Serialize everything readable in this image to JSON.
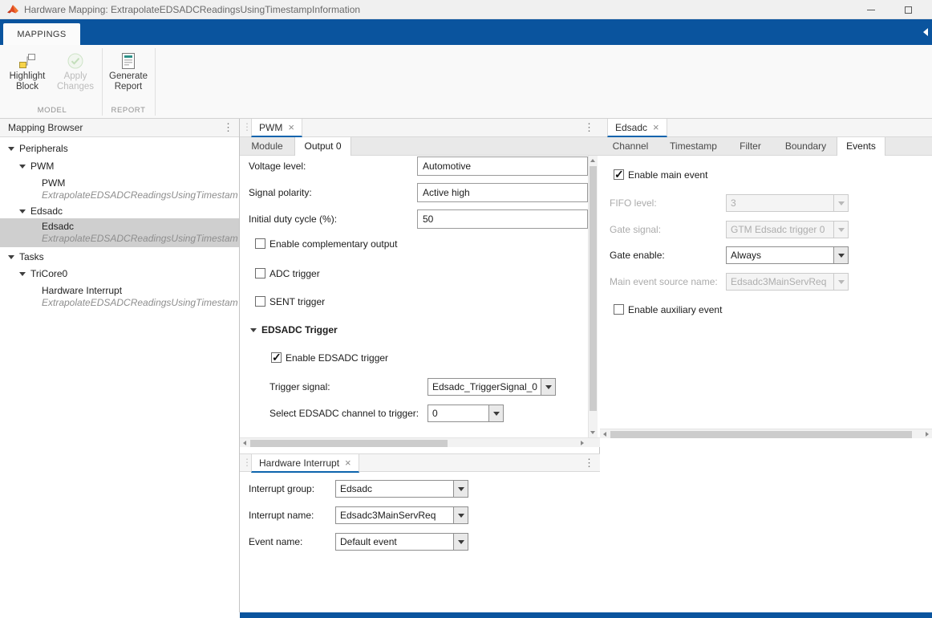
{
  "colors": {
    "ribbon_blue": "#0a549e",
    "tab_accent": "#0d64ad",
    "selected_tree_bg": "#cfcfcf"
  },
  "icons": {
    "menu_dots": "⋮",
    "close": "×"
  },
  "title_bar": {
    "title": "Hardware Mapping: ExtrapolateEDSADCReadingsUsingTimestampInformation"
  },
  "ribbon": {
    "tab": "MAPPINGS"
  },
  "toolbar": {
    "highlight_block": {
      "line1": "Highlight",
      "line2": "Block"
    },
    "apply_changes": {
      "line1": "Apply",
      "line2": "Changes"
    },
    "generate_report": {
      "line1": "Generate",
      "line2": "Report"
    },
    "sections": {
      "model": "MODEL",
      "report": "REPORT"
    }
  },
  "browser": {
    "header": "Mapping Browser",
    "items": [
      {
        "label": "Peripherals"
      },
      {
        "label": "PWM"
      },
      {
        "label": "PWM",
        "sub": "ExtrapolateEDSADCReadingsUsingTimestam"
      },
      {
        "label": "Edsadc"
      },
      {
        "label": "Edsadc",
        "sub": "ExtrapolateEDSADCReadingsUsingTimestam",
        "selected": true
      },
      {
        "label": "Tasks"
      },
      {
        "label": "TriCore0"
      },
      {
        "label": "Hardware Interrupt",
        "sub": "ExtrapolateEDSADCReadingsUsingTimestam"
      }
    ]
  },
  "pwm": {
    "tab": "PWM",
    "subtabs": [
      "Module",
      "Output 0"
    ],
    "active_subtab": "Output 0",
    "voltage_level": {
      "label": "Voltage level:",
      "value": "Automotive"
    },
    "signal_polarity": {
      "label": "Signal polarity:",
      "value": "Active high"
    },
    "initial_duty": {
      "label": "Initial duty cycle (%):",
      "value": "50"
    },
    "enable_complementary": {
      "label": "Enable complementary output",
      "checked": false
    },
    "adc_trigger": {
      "label": "ADC trigger",
      "checked": false
    },
    "sent_trigger": {
      "label": "SENT trigger",
      "checked": false
    },
    "edsadc_trigger_section": "EDSADC Trigger",
    "enable_edsadc_trigger": {
      "label": "Enable EDSADC trigger",
      "checked": true
    },
    "trigger_signal": {
      "label": "Trigger signal:",
      "value": "Edsadc_TriggerSignal_0"
    },
    "edsadc_channel": {
      "label": "Select EDSADC channel to trigger:",
      "value": "0"
    }
  },
  "edsadc": {
    "tab": "Edsadc",
    "subtabs": [
      "Channel",
      "Timestamp",
      "Filter",
      "Boundary",
      "Events"
    ],
    "active_subtab": "Events",
    "enable_main_event": {
      "label": "Enable main event",
      "checked": true
    },
    "fifo_level": {
      "label": "FIFO level:",
      "value": "3",
      "disabled": true
    },
    "gate_signal": {
      "label": "Gate signal:",
      "value": "GTM Edsadc trigger 0",
      "disabled": true
    },
    "gate_enable": {
      "label": "Gate enable:",
      "value": "Always",
      "disabled": false
    },
    "main_event_source": {
      "label": "Main event source name:",
      "value": "Edsadc3MainServReq",
      "disabled": true
    },
    "enable_aux_event": {
      "label": "Enable auxiliary event",
      "checked": false
    }
  },
  "hw_interrupt": {
    "tab": "Hardware Interrupt",
    "interrupt_group": {
      "label": "Interrupt group:",
      "value": "Edsadc"
    },
    "interrupt_name": {
      "label": "Interrupt name:",
      "value": "Edsadc3MainServReq"
    },
    "event_name": {
      "label": "Event name:",
      "value": "Default event"
    }
  }
}
